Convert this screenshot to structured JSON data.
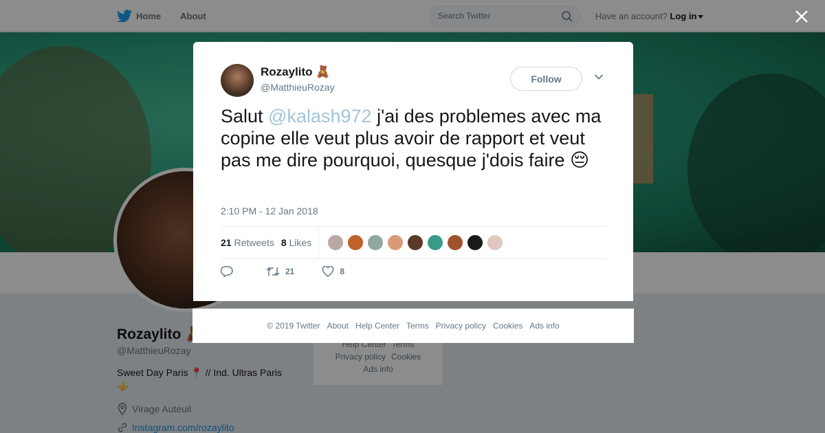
{
  "nav": {
    "home_label": "Home",
    "about_label": "About",
    "search_placeholder": "Search Twitter",
    "have_account_label": "Have an account?",
    "login_label": "Log in"
  },
  "profile": {
    "name": "Rozaylito 🧸",
    "handle": "@MatthieuRozay",
    "bio": "Sweet Day Paris 📍 // Ind. Ultras Paris ⚜️",
    "location": "Virage Auteuil",
    "link": "Instagram.com/rozaylito"
  },
  "bg_footer": {
    "line1": [
      "Help Center",
      "Terms"
    ],
    "line2": [
      "Privacy policy",
      "Cookies"
    ],
    "line3": [
      "Ads info"
    ]
  },
  "tweet": {
    "author_name": "Rozaylito 🧸",
    "author_handle": "@MatthieuRozay",
    "follow_label": "Follow",
    "text_before": "Salut ",
    "mention": "@kalash972",
    "text_after": " j'ai des problemes avec ma copine elle veut plus avoir de rapport et veut pas me dire pourquoi, quesque j'dois faire 😔",
    "timestamp": "2:10 PM - 12 Jan 2018",
    "retweets_count": "21",
    "retweets_label": "Retweets",
    "likes_count": "8",
    "likes_label": "Likes",
    "action_retweet_count": "21",
    "action_like_count": "8",
    "liker_colors": [
      "#b9a9a6",
      "#c0602a",
      "#8fa8a0",
      "#d99a7a",
      "#5a3a2a",
      "#3a9a8a",
      "#a0522d",
      "#1a1a1a",
      "#e0c8c0"
    ]
  },
  "footer": {
    "items": [
      "© 2019 Twitter",
      "About",
      "Help Center",
      "Terms",
      "Privacy policy",
      "Cookies",
      "Ads info"
    ]
  },
  "colors": {
    "brand": "#1da1f2",
    "mention": "#a3c4da",
    "muted": "#657786"
  }
}
